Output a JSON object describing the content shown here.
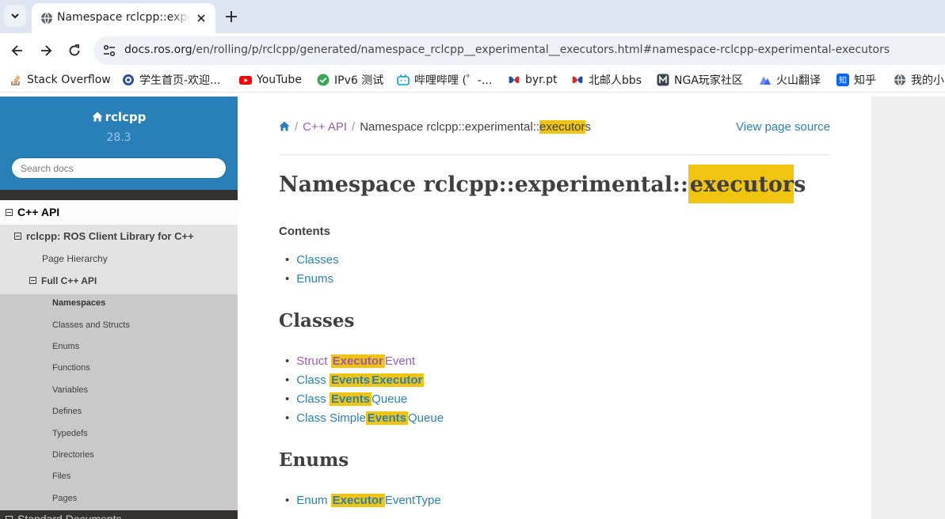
{
  "browser": {
    "tab_title": "Namespace rclcpp::experimental::executors",
    "url_host": "docs.ros.org",
    "url_path": "/en/rolling/p/rclcpp/generated/namespace_rclcpp__experimental__executors.html#namespace-rclcpp-experimental-executors",
    "bookmarks": [
      {
        "label": "Stack Overflow",
        "icon": "stackoverflow-icon"
      },
      {
        "label": "学生首页-欢迎...",
        "icon": "globe-icon"
      },
      {
        "label": "YouTube",
        "icon": "youtube-icon"
      },
      {
        "label": "IPv6 测试",
        "icon": "check-circle-icon"
      },
      {
        "label": "哔哩哔哩 (゜-...",
        "icon": "bilibili-icon"
      },
      {
        "label": "byr.pt",
        "icon": "butterfly-icon"
      },
      {
        "label": "北邮人bbs",
        "icon": "butterfly-icon"
      },
      {
        "label": "NGA玩家社区",
        "icon": "nga-icon"
      },
      {
        "label": "火山翻译",
        "icon": "volcano-icon"
      },
      {
        "label": "知乎",
        "icon": "zhihu-icon"
      },
      {
        "label": "我的小",
        "icon": "globe-icon"
      }
    ],
    "colors": {
      "tabstrip": "#dfe6f3",
      "omnibox": "#eef1f8"
    }
  },
  "sidebar": {
    "project": "rclcpp",
    "version": "28.3",
    "search_placeholder": "Search docs",
    "nav": {
      "cpp_api": "C++ API",
      "rclcpp_lib": "rclcpp: ROS Client Library for C++",
      "page_hierarchy": "Page Hierarchy",
      "full_api": "Full C++ API",
      "items": [
        "Namespaces",
        "Classes and Structs",
        "Enums",
        "Functions",
        "Variables",
        "Defines",
        "Typedefs",
        "Directories",
        "Files",
        "Pages"
      ],
      "next_section": "Standard Documents"
    },
    "colors": {
      "header": "#2980b9",
      "dark": "#343131"
    }
  },
  "main": {
    "breadcrumbs": {
      "current_pre": "Namespace rclcpp::experimental::",
      "current_match": "executor",
      "current_post": "s",
      "cpp_api": "C++ API",
      "sep": "/"
    },
    "view_source": "View page source",
    "title_pre": "Namespace rclcpp::experimental::",
    "title_match": "executor",
    "title_post": "s",
    "contents_title": "Contents",
    "toc": [
      "Classes",
      "Enums"
    ],
    "classes_heading": "Classes",
    "classes": [
      {
        "pre": "Struct ",
        "match": "Executor",
        "post": "Event"
      },
      {
        "pre": "Class ",
        "match": "Events",
        "match2": "Executor"
      },
      {
        "pre": "Class ",
        "match": "Events",
        "post": "Queue"
      },
      {
        "pre": "Class Simple",
        "match": "Events",
        "post": "Queue"
      }
    ],
    "enums_heading": "Enums",
    "enums": [
      {
        "pre": "Enum ",
        "match": "Executor",
        "post": "EventType"
      }
    ],
    "colors": {
      "link": "#2980b9",
      "visited": "#9b59b6",
      "highlight": "#f1c40f"
    }
  }
}
